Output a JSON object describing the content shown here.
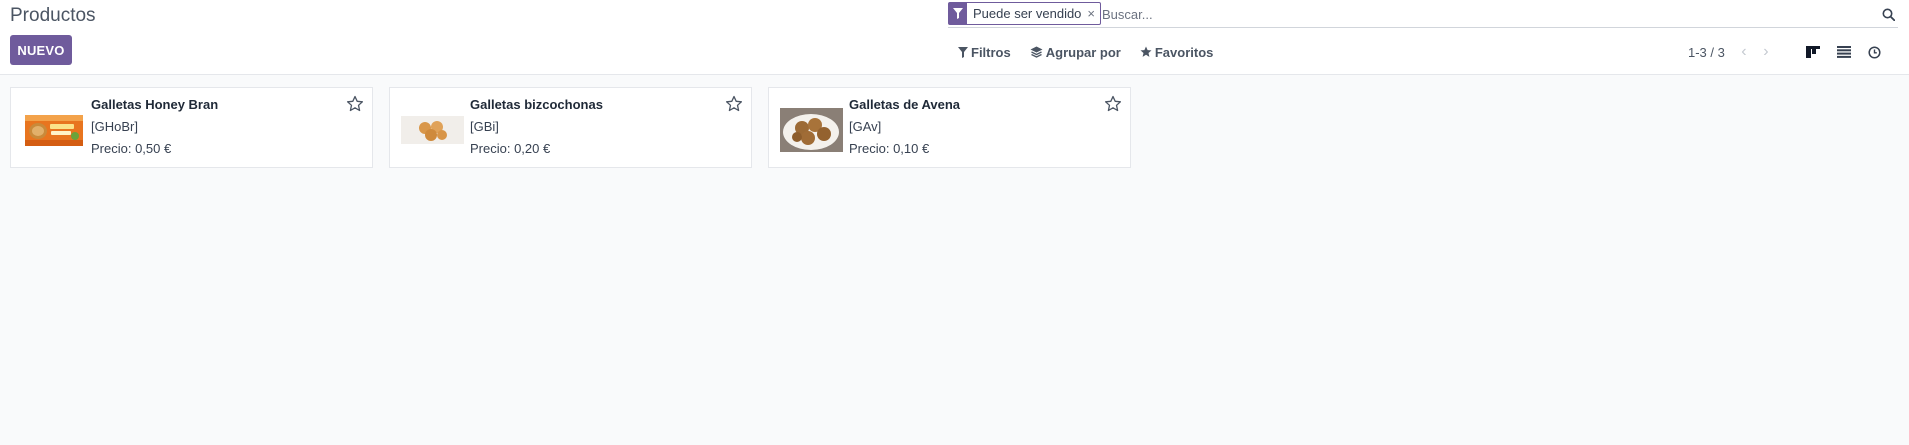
{
  "header": {
    "title": "Productos",
    "new_button": "NUEVO"
  },
  "search": {
    "facet_label": "Puede ser vendido",
    "facet_remove": "×",
    "placeholder": "Buscar..."
  },
  "toolbar": {
    "filters": "Filtros",
    "group_by": "Agrupar por",
    "favorites": "Favoritos"
  },
  "pager": {
    "value": "1-3 / 3",
    "prev": "‹",
    "next": "›"
  },
  "views": [
    "kanban",
    "list",
    "activity"
  ],
  "colors": {
    "accent": "#6f5b9c",
    "background": "#f9fafb"
  },
  "products": [
    {
      "name": "Galletas Honey Bran",
      "ref": "[GHoBr]",
      "price": "Precio: 0,50 €",
      "image": "biscuit-pack"
    },
    {
      "name": "Galletas bizcochonas",
      "ref": "[GBi]",
      "price": "Precio: 0,20 €",
      "image": "sponge-biscuits"
    },
    {
      "name": "Galletas de Avena",
      "ref": "[GAv]",
      "price": "Precio: 0,10 €",
      "image": "oat-cookies-plate"
    }
  ]
}
